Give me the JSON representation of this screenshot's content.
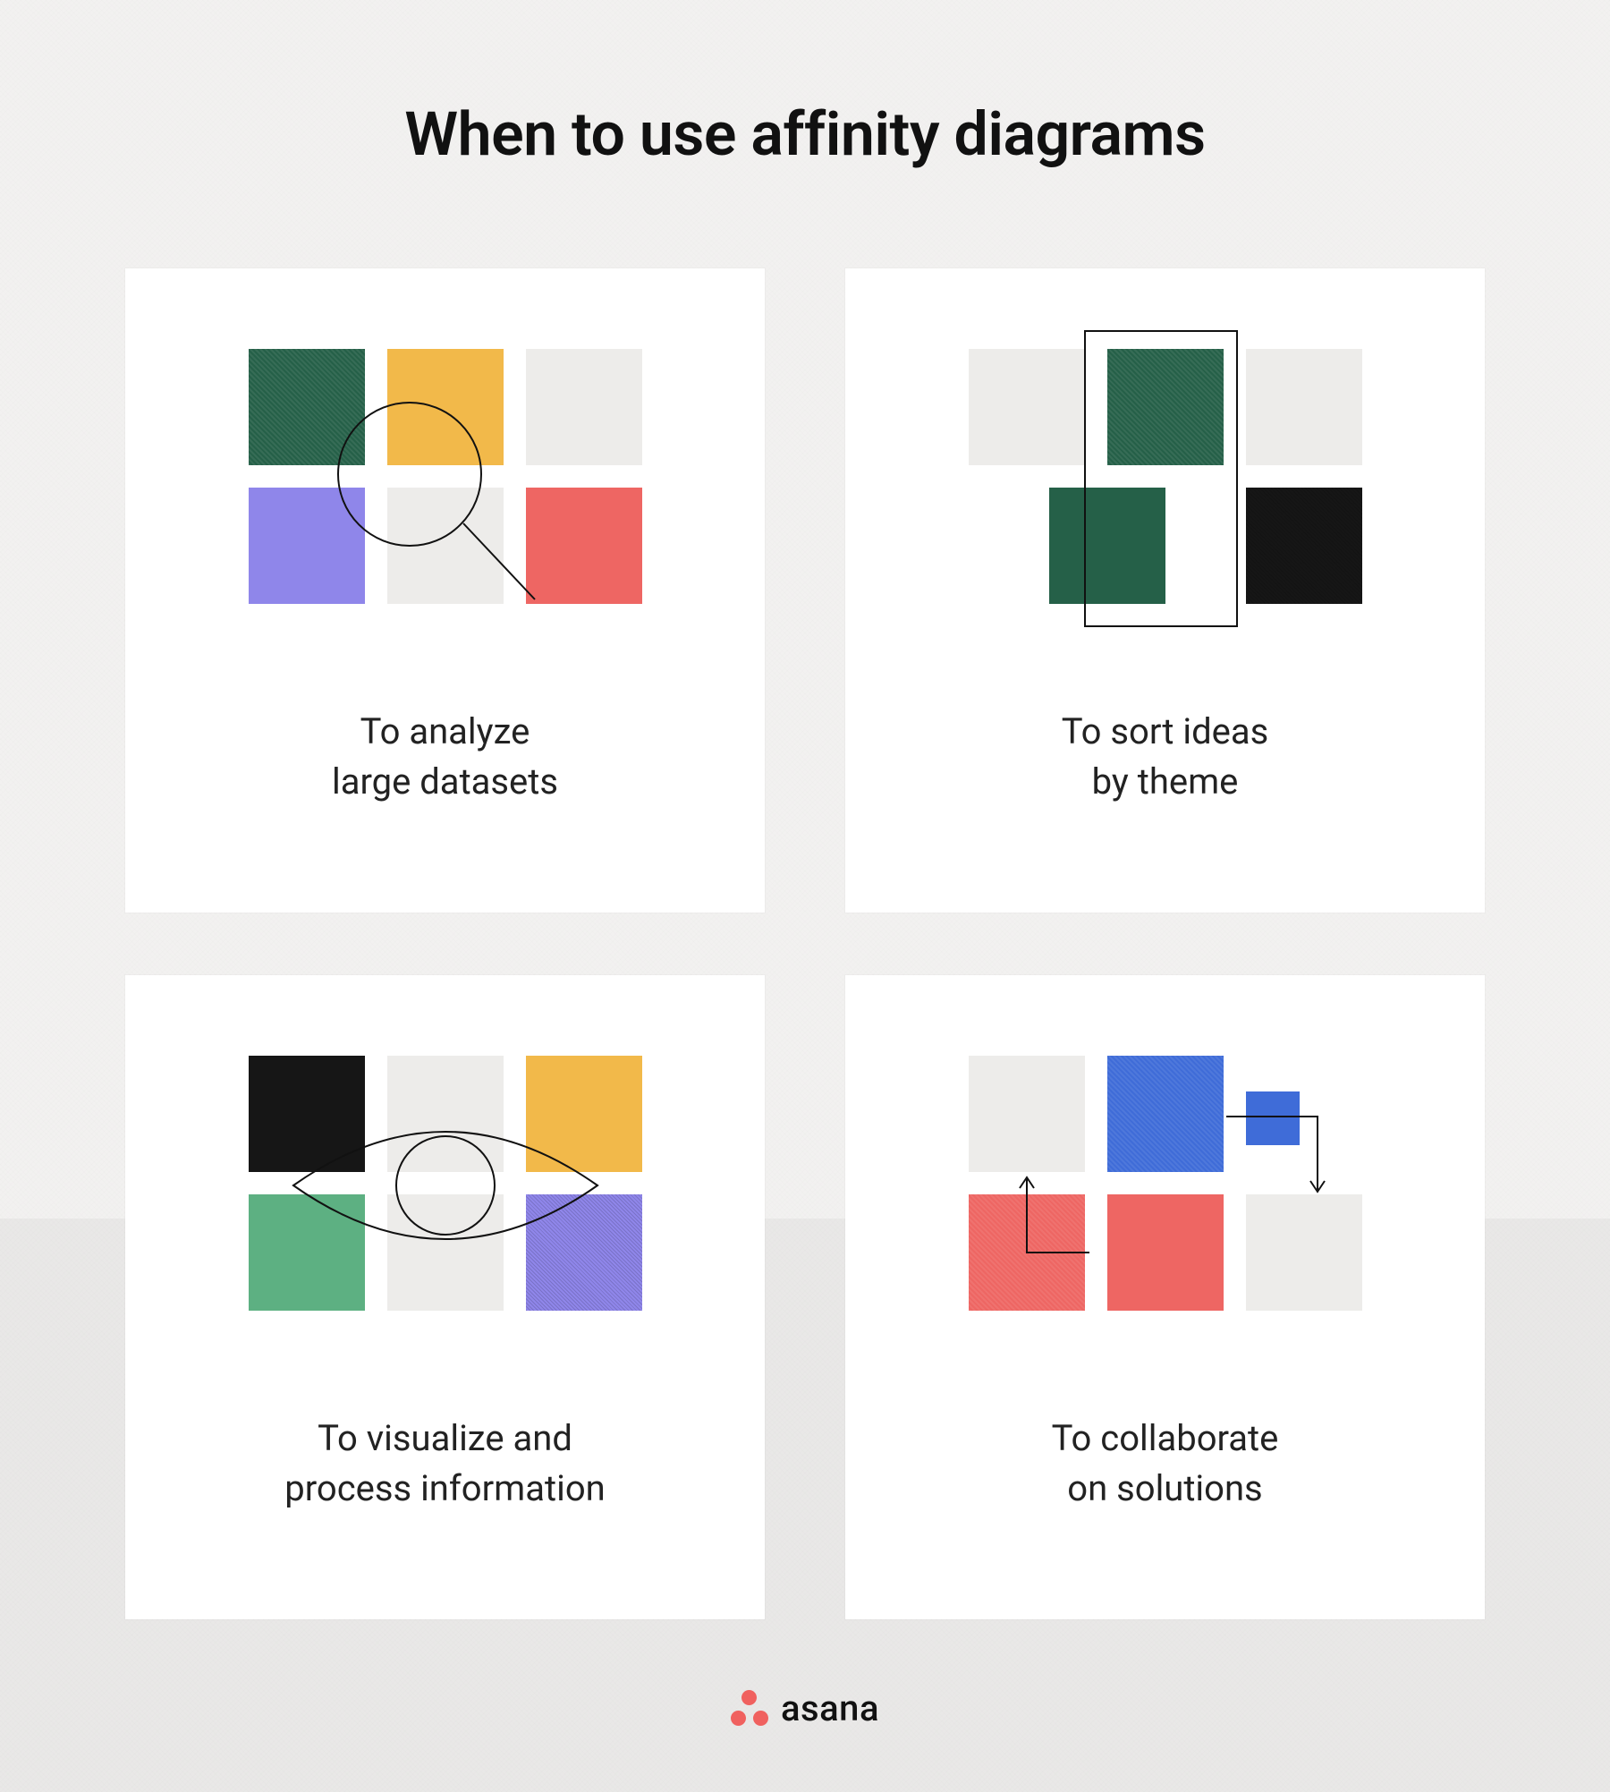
{
  "title": "When to use affinity diagrams",
  "cards": {
    "analyze": {
      "line1": "To analyze",
      "line2": "large datasets"
    },
    "sort": {
      "line1": "To sort ideas",
      "line2": "by theme"
    },
    "visualize": {
      "line1": "To visualize and",
      "line2": "process information"
    },
    "collaborate": {
      "line1": "To collaborate",
      "line2": "on solutions"
    }
  },
  "brand": {
    "name": "asana"
  },
  "palette": {
    "green_dark": "#256048",
    "green_mid": "#5db082",
    "yellow": "#f2b94a",
    "purple": "#8f86ea",
    "red": "#ee6663",
    "black": "#161616",
    "blue": "#3f6cd8",
    "lightgrey": "#edecea",
    "accent_logo": "#f0615f"
  }
}
